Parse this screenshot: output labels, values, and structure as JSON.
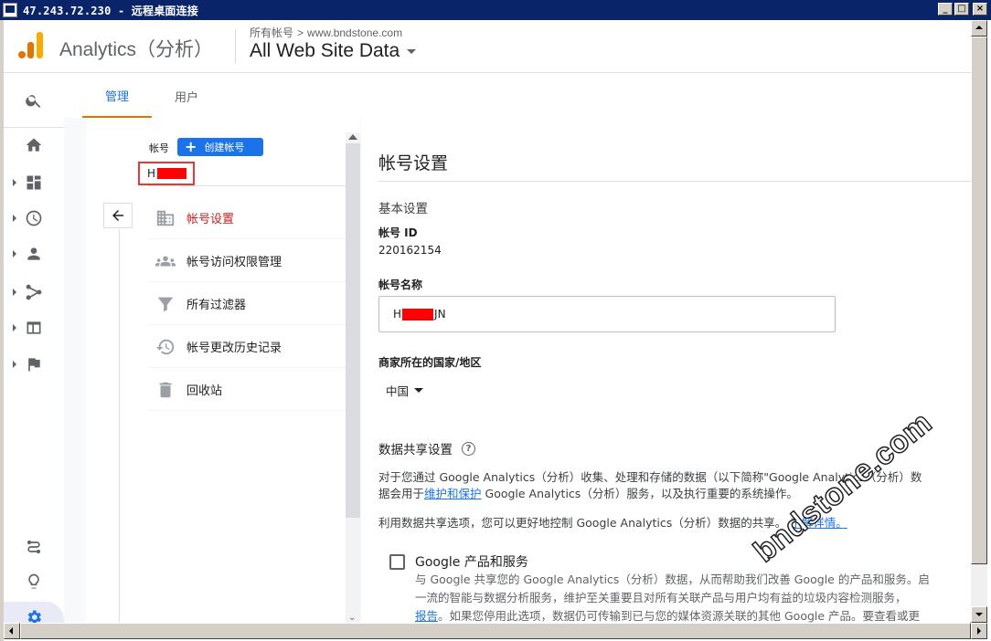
{
  "window": {
    "title": "47.243.72.230 - 远程桌面连接"
  },
  "header": {
    "app_name": "Analytics（分析）",
    "breadcrumb": [
      "所有帐号",
      "www.bndstone.com"
    ],
    "property_label": "All Web Site Data"
  },
  "tabs": [
    {
      "label": "管理",
      "active": true
    },
    {
      "label": "用户",
      "active": false
    }
  ],
  "account_column": {
    "label": "帐号",
    "create_button": "创建帐号",
    "account_name_visible": "H",
    "menu": [
      {
        "label": "帐号设置",
        "icon": "building-icon",
        "active": true
      },
      {
        "label": "帐号访问权限管理",
        "icon": "people-icon",
        "active": false
      },
      {
        "label": "所有过滤器",
        "icon": "filter-icon",
        "active": false
      },
      {
        "label": "帐号更改历史记录",
        "icon": "history-icon",
        "active": false
      },
      {
        "label": "回收站",
        "icon": "trash-icon",
        "active": false
      }
    ]
  },
  "settings": {
    "title": "帐号设置",
    "basic_settings": "基本设置",
    "account_id_label": "帐号 ID",
    "account_id": "220162154",
    "account_name_label": "帐号名称",
    "account_name_prefix": "H",
    "account_name_suffix": "JN",
    "country_label": "商家所在的国家/地区",
    "country_value": "中国",
    "data_sharing_title": "数据共享设置",
    "para1_line1": "对于您通过 Google Analytics（分析）收集、处理和存储的数据（以下简称\"Google Analytics（分析）数",
    "para1_line2_pre": "据会用于",
    "para1_link": "维护和保护",
    "para1_line2_post": " Google Analytics（分析）服务，以及执行重要的系统操作。",
    "para2_text": "利用数据共享选项，您可以更好地控制 Google Analytics（分析）数据的共享。",
    "para2_link": "了解详情。",
    "option1_title": "Google 产品和服务",
    "option1_line1": "与 Google 共享您的 Google Analytics（分析）数据，从而帮助我们改善 Google 的产品和服务。启",
    "option1_line2": "一流的智能与数据分析服务，维护至关重要且对所有关联产品与用户均有益的垃圾内容检测服务，",
    "option1_line3_link": "报告",
    "option1_line3_post": "。如果您停用此选项，数据仍可传输到已与您的媒体资源关联的其他 Google 产品。要查看或更"
  },
  "nav_icons": [
    "search-icon",
    "home-icon",
    "dashboard-icon",
    "clock-icon",
    "person-icon",
    "acquisition-icon",
    "behavior-icon",
    "flag-icon",
    "route-icon",
    "lightbulb-icon",
    "gear-icon"
  ],
  "watermark": "bndstone.com"
}
